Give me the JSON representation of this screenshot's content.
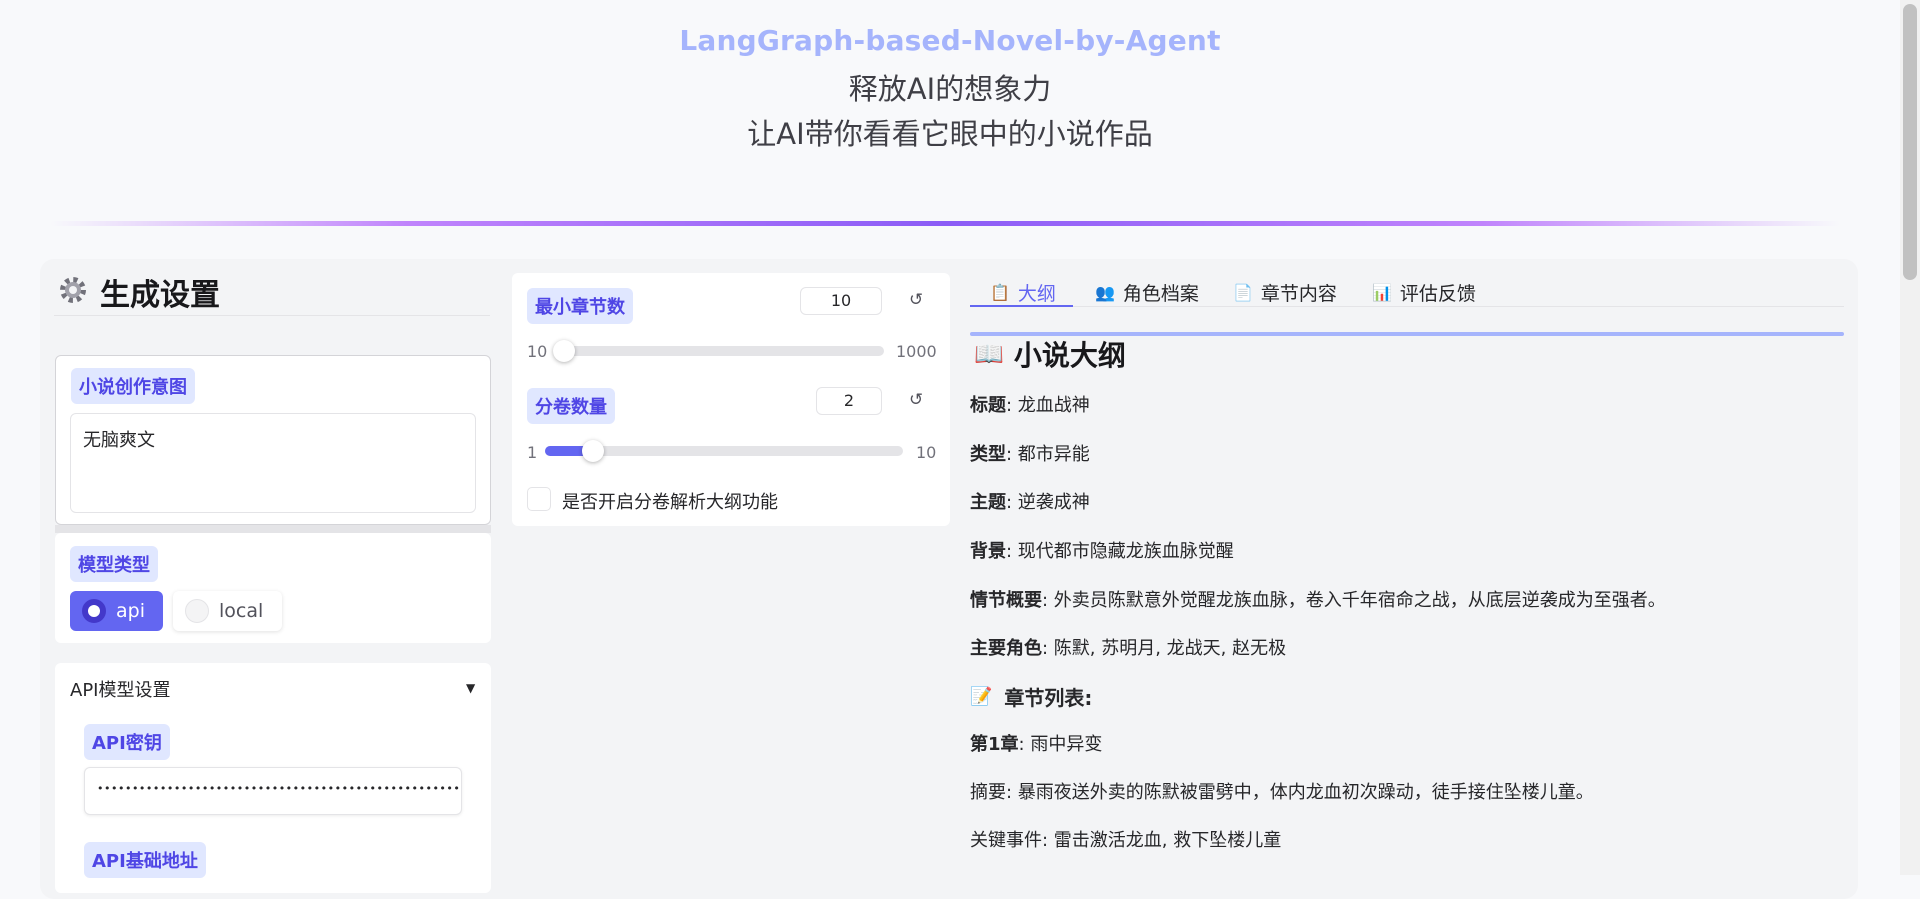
{
  "header": {
    "app_title": "LangGraph-based-Novel-by-Agent",
    "tagline_1": "释放AI的想象力",
    "tagline_2": "让AI带你看看它眼中的小说作品"
  },
  "settings": {
    "title": "生成设置",
    "intent": {
      "label": "小说创作意图",
      "value": "无脑爽文"
    },
    "model_type": {
      "label": "模型类型",
      "options": [
        "api",
        "local"
      ],
      "selected": "api"
    },
    "api_settings": {
      "accordion_label": "API模型设置",
      "chevron": "▼",
      "key_label": "API密钥",
      "key_value": "••••••••••••••••••••••••••••••••••••••••••••••••••••••",
      "base_url_label": "API基础地址"
    },
    "min_chapters": {
      "label": "最小章节数",
      "value": "10",
      "min": "10",
      "max": "1000",
      "level": 0.0
    },
    "volumes": {
      "label": "分卷数量",
      "value": "2",
      "min": "1",
      "max": "10",
      "level": 0.111
    },
    "split_outline_checkbox": {
      "label": "是否开启分卷解析大纲功能",
      "checked": false
    },
    "reset_glyph": "↺"
  },
  "tabs": [
    {
      "label": "大纲",
      "icon": "clipboard-icon",
      "active": true
    },
    {
      "label": "角色档案",
      "icon": "people-icon",
      "active": false
    },
    {
      "label": "章节内容",
      "icon": "page-icon",
      "active": false
    },
    {
      "label": "评估反馈",
      "icon": "bar-chart-icon",
      "active": false
    }
  ],
  "outline": {
    "heading": "小说大纲",
    "title_label": "标题",
    "title_value": ": 龙血战神",
    "genre_label": "类型",
    "genre_value": ": 都市异能",
    "theme_label": "主题",
    "theme_value": ": 逆袭成神",
    "background_label": "背景",
    "background_value": ": 现代都市隐藏龙族血脉觉醒",
    "plot_label": "情节概要",
    "plot_value": ": 外卖员陈默意外觉醒龙族血脉，卷入千年宿命之战，从底层逆袭成为至强者。",
    "characters_label": "主要角色",
    "characters_value": ": 陈默, 苏明月, 龙战天, 赵无极",
    "chapter_list_heading": "章节列表:",
    "chapter1_label": "第1章",
    "chapter1_value": ": 雨中异变",
    "summary": "摘要: 暴雨夜送外卖的陈默被雷劈中，体内龙血初次躁动，徒手接住坠楼儿童。",
    "key_events": "关键事件: 雷击激活龙血, 救下坠楼儿童"
  },
  "colors": {
    "accent": "#6366f1",
    "pill_bg": "#e0e7ff",
    "title_gradient": "#a5b4fc"
  }
}
